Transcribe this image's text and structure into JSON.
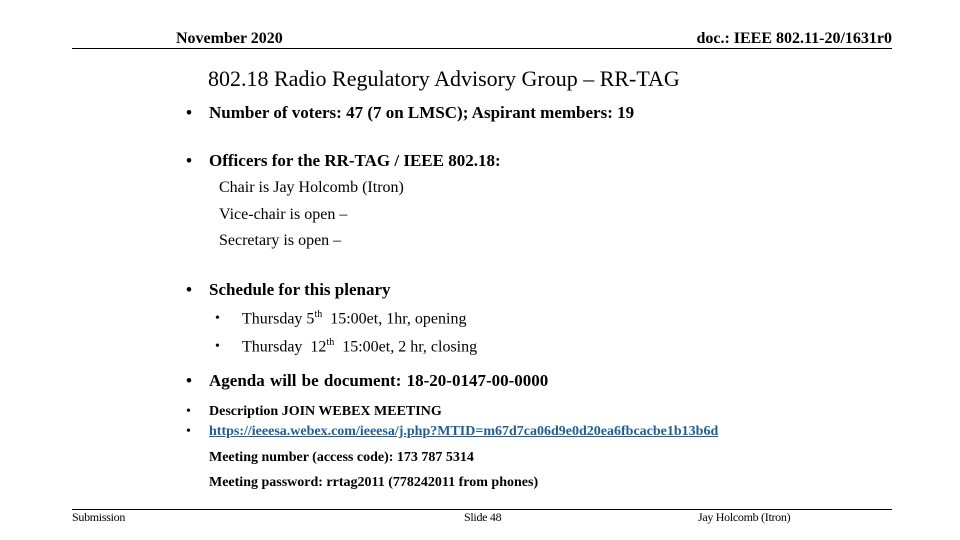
{
  "header": {
    "date": "November 2020",
    "doc_id": "doc.: IEEE 802.11-20/1631r0"
  },
  "slide": {
    "title": "802.18 Radio Regulatory Advisory Group – RR-TAG",
    "bullets": {
      "voters": "Number of voters:  47 (7 on LMSC);  Aspirant members: 19",
      "officers": {
        "heading": "Officers for the RR-TAG / IEEE 802.18:",
        "lines": [
          "Chair is Jay Holcomb (Itron)",
          "Vice-chair is open –",
          "Secretary is open –"
        ]
      },
      "schedule": {
        "heading": "Schedule for this plenary",
        "items": [
          {
            "day": "Thursday 5",
            "sup": "th",
            "rest": "  15:00et, 1hr, opening"
          },
          {
            "day": "Thursday  12",
            "sup": "th",
            "rest": "  15:00et, 2 hr, closing"
          }
        ]
      },
      "agenda": "Agenda will be document:  18-20-0147-00-0000",
      "webex": {
        "description": "Description JOIN WEBEX MEETING",
        "link": "https://ieeesa.webex.com/ieeesa/j.php?MTID=m67d7ca06d9e0d20ea6fbcacbe1b13b6d",
        "meeting_number": "Meeting number (access code): 173 787 5314",
        "password": "Meeting password: rrtag2011 (778242011 from phones)"
      }
    },
    "bullet_glyph": "•"
  },
  "footer": {
    "left": "Submission",
    "center": "Slide 48",
    "right": "Jay Holcomb (Itron)"
  }
}
